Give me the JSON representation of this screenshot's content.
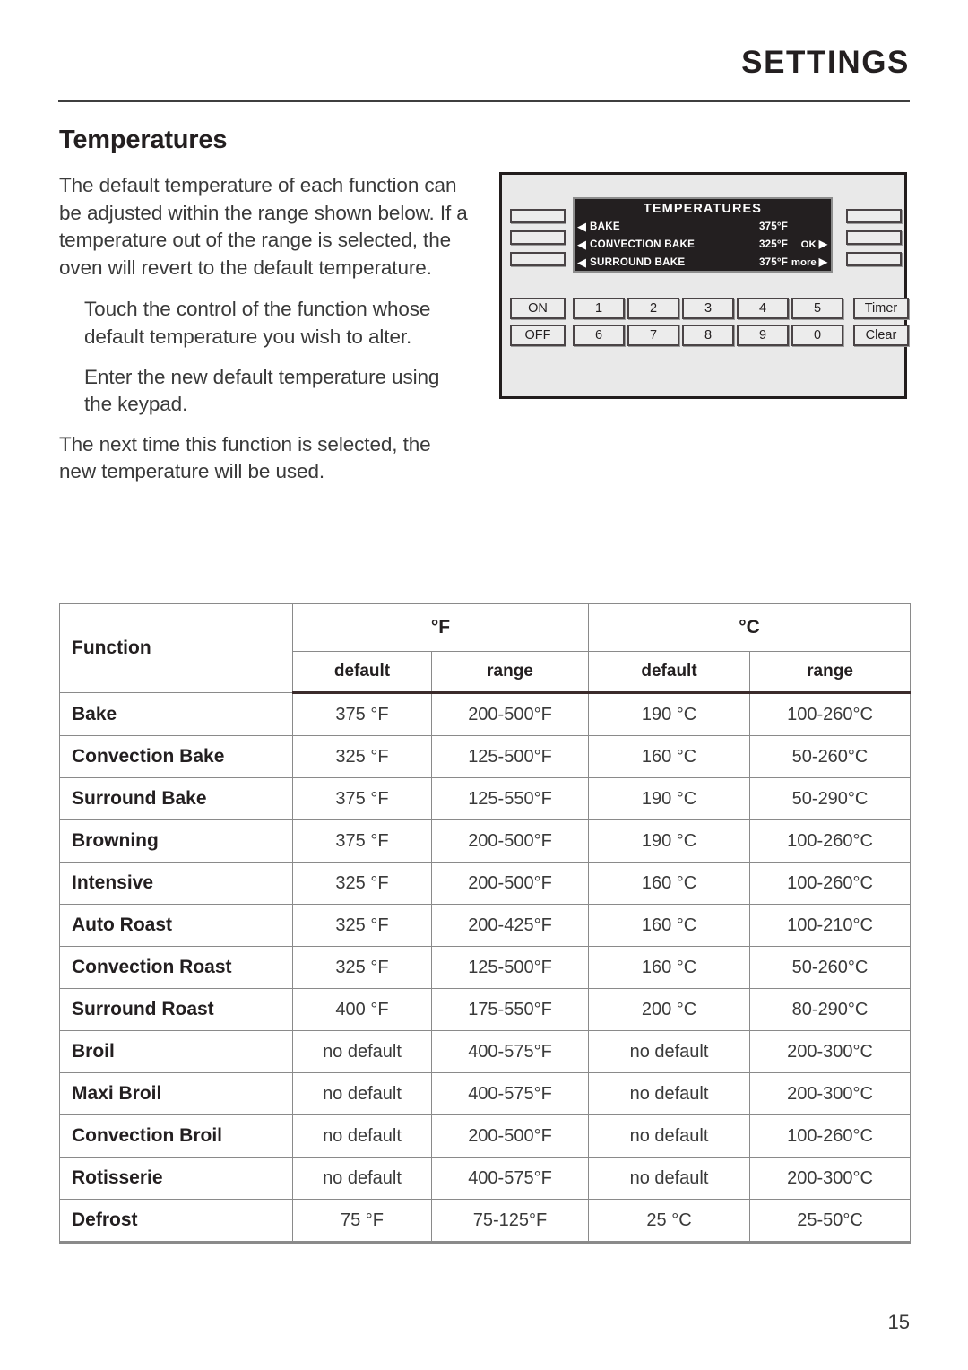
{
  "header": {
    "title": "SETTINGS"
  },
  "section": {
    "heading": "Temperatures",
    "paragraphs": [
      "The default temperature of each function can be adjusted within the range shown below. If a temperature out of the range is selected, the oven will revert to the default temperature.",
      "Touch the control of the function whose default temperature you wish to alter.",
      "Enter the new default temperature using the keypad.",
      "The next time this function is selected, the new temperature will be used."
    ]
  },
  "control_panel": {
    "display": {
      "title": "TEMPERATURES",
      "rows": [
        {
          "arrow": "◀",
          "label": "BAKE",
          "temp": "375°F",
          "action": "",
          "action_arrow": ""
        },
        {
          "arrow": "◀",
          "label": "CONVECTION BAKE",
          "temp": "325°F",
          "action": "OK",
          "action_arrow": "▶"
        },
        {
          "arrow": "◀",
          "label": "SURROUND BAKE",
          "temp": "375°F",
          "action": "more",
          "action_arrow": "▶"
        }
      ]
    },
    "softkeys_left_count": 3,
    "softkeys_right_count": 3,
    "keys": {
      "on": "ON",
      "off": "OFF",
      "timer": "Timer",
      "clear": "Clear",
      "numbers_row1": [
        "1",
        "2",
        "3",
        "4",
        "5"
      ],
      "numbers_row2": [
        "6",
        "7",
        "8",
        "9",
        "0"
      ]
    }
  },
  "table": {
    "headers": {
      "function": "Function",
      "fahrenheit": "°F",
      "celsius": "°C",
      "default": "default",
      "range": "range"
    },
    "rows": [
      {
        "function": "Bake",
        "f_default": "375 °F",
        "f_range": "200-500°F",
        "c_default": "190 °C",
        "c_range": "100-260°C"
      },
      {
        "function": "Convection Bake",
        "f_default": "325 °F",
        "f_range": "125-500°F",
        "c_default": "160 °C",
        "c_range": "50-260°C"
      },
      {
        "function": "Surround Bake",
        "f_default": "375 °F",
        "f_range": "125-550°F",
        "c_default": "190 °C",
        "c_range": "50-290°C"
      },
      {
        "function": "Browning",
        "f_default": "375 °F",
        "f_range": "200-500°F",
        "c_default": "190 °C",
        "c_range": "100-260°C"
      },
      {
        "function": "Intensive",
        "f_default": "325 °F",
        "f_range": "200-500°F",
        "c_default": "160 °C",
        "c_range": "100-260°C"
      },
      {
        "function": "Auto Roast",
        "f_default": "325 °F",
        "f_range": "200-425°F",
        "c_default": "160 °C",
        "c_range": "100-210°C"
      },
      {
        "function": "Convection Roast",
        "f_default": "325 °F",
        "f_range": "125-500°F",
        "c_default": "160 °C",
        "c_range": "50-260°C"
      },
      {
        "function": "Surround Roast",
        "f_default": "400 °F",
        "f_range": "175-550°F",
        "c_default": "200 °C",
        "c_range": "80-290°C"
      },
      {
        "function": "Broil",
        "f_default": "no default",
        "f_range": "400-575°F",
        "c_default": "no default",
        "c_range": "200-300°C"
      },
      {
        "function": "Maxi Broil",
        "f_default": "no default",
        "f_range": "400-575°F",
        "c_default": "no default",
        "c_range": "200-300°C"
      },
      {
        "function": "Convection Broil",
        "f_default": "no default",
        "f_range": "200-500°F",
        "c_default": "no default",
        "c_range": "100-260°C"
      },
      {
        "function": "Rotisserie",
        "f_default": "no default",
        "f_range": "400-575°F",
        "c_default": "no default",
        "c_range": "200-300°C"
      },
      {
        "function": "Defrost",
        "f_default": "75 °F",
        "f_range": "75-125°F",
        "c_default": "25 °C",
        "c_range": "25-50°C"
      }
    ]
  },
  "footer": {
    "page_number": "15"
  }
}
